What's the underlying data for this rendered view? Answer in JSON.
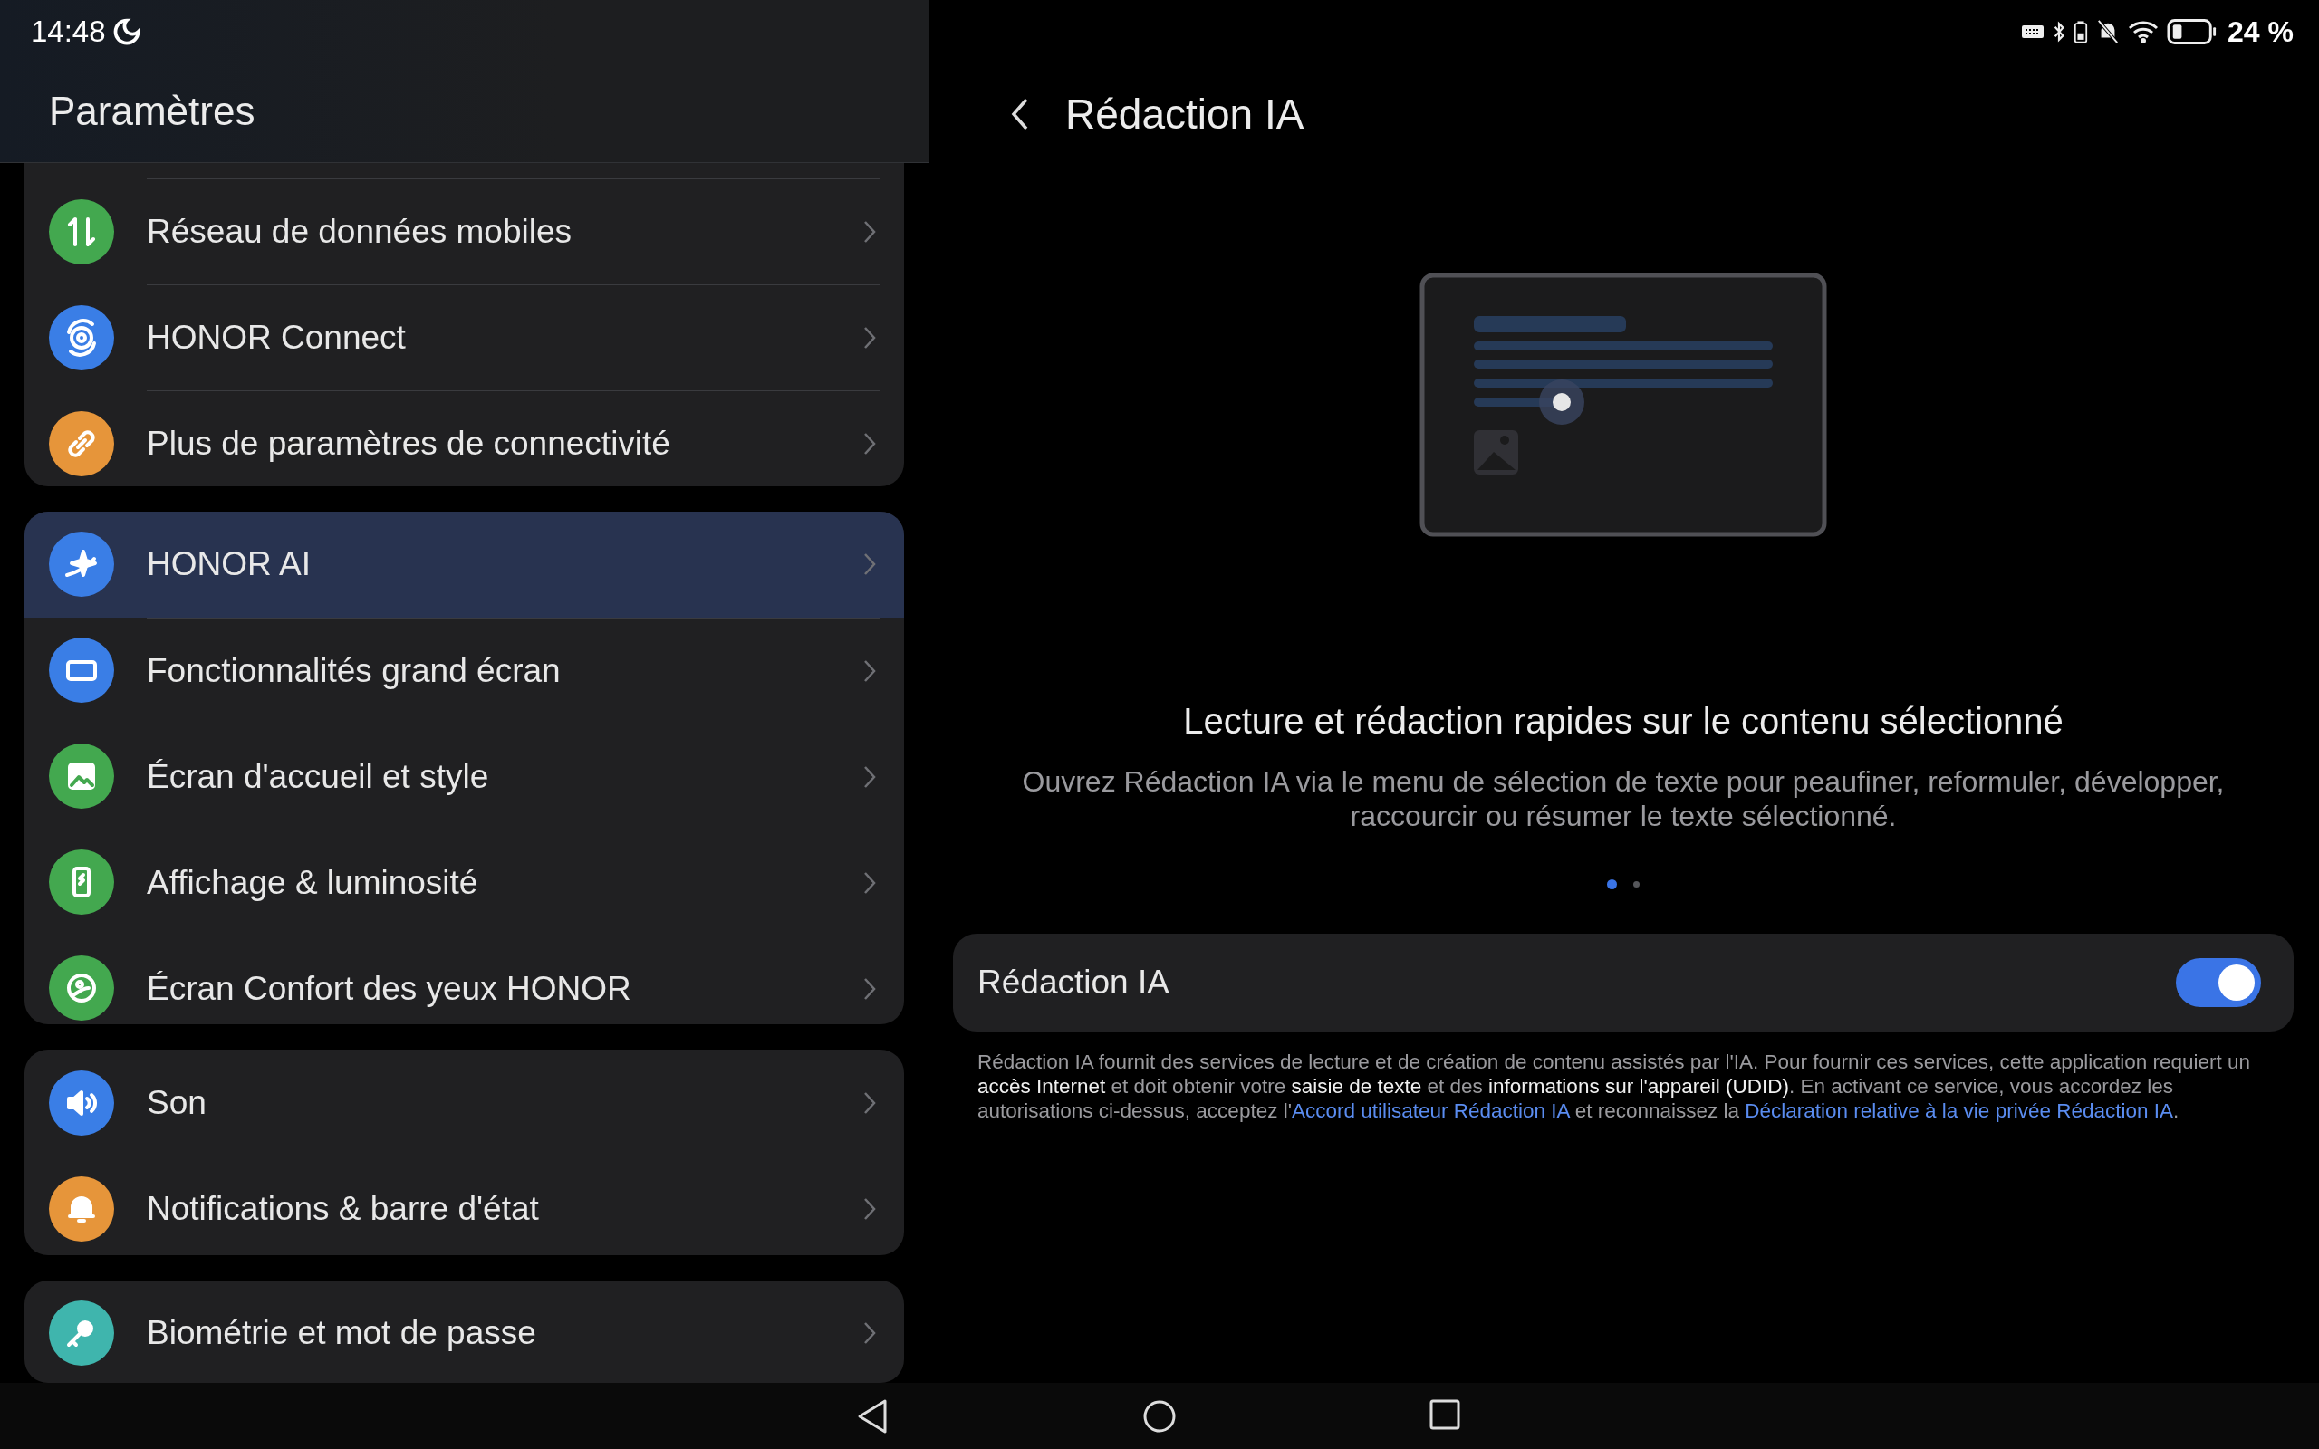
{
  "status_bar": {
    "time": "14:48",
    "battery": "24 %"
  },
  "settings": {
    "title": "Paramètres",
    "groups": [
      {
        "items": [
          {
            "label": "Réseau de données mobiles",
            "kind": "data",
            "color": "#43a84f",
            "selected": false
          },
          {
            "label": "HONOR Connect",
            "kind": "connect",
            "color": "#3a7ee6",
            "selected": false
          },
          {
            "label": "Plus de paramètres de connectivité",
            "kind": "link",
            "color": "#e6953a",
            "selected": false
          }
        ]
      },
      {
        "items": [
          {
            "label": "HONOR AI",
            "kind": "ai",
            "color": "#3a7ee6",
            "selected": true
          },
          {
            "label": "Fonctionnalités grand écran",
            "kind": "screen",
            "color": "#3a7ee6",
            "selected": false
          },
          {
            "label": "Écran d'accueil et style",
            "kind": "image",
            "color": "#43a84f",
            "selected": false
          },
          {
            "label": "Affichage & luminosité",
            "kind": "display",
            "color": "#43a84f",
            "selected": false
          },
          {
            "label": "Écran Confort des yeux HONOR",
            "kind": "eye",
            "color": "#43a84f",
            "selected": false
          }
        ]
      },
      {
        "items": [
          {
            "label": "Son",
            "kind": "sound",
            "color": "#3a7ee6",
            "selected": false
          },
          {
            "label": "Notifications & barre d'état",
            "kind": "bell",
            "color": "#e6953a",
            "selected": false
          }
        ]
      },
      {
        "items": [
          {
            "label": "Biométrie et mot de passe",
            "kind": "key",
            "color": "#3fb5ad",
            "selected": false
          }
        ]
      }
    ]
  },
  "detail": {
    "title": "Rédaction IA",
    "heading": "Lecture et rédaction rapides sur le contenu sélectionné",
    "description": "Ouvrez Rédaction IA via le menu de sélection de texte pour peaufiner, reformuler, développer, raccourcir ou résumer le texte sélectionné.",
    "pages": [
      {
        "selected": true
      },
      {
        "selected": false
      }
    ],
    "switch": {
      "label": "Rédaction IA",
      "on": true
    },
    "disclaimer": [
      {
        "kind": "text",
        "text": "Rédaction IA fournit des services de lecture et de création de contenu assistés par l'IA. Pour fournir ces services, cette application requiert un **accès Internet** et doit obtenir votre **saisie de texte** et des **informations sur l'appareil (UDID)**. En activant ce service, vous accordez les autorisations ci-dessus, acceptez l'"
      },
      {
        "kind": "link",
        "text": "Accord utilisateur Rédaction IA"
      },
      {
        "kind": "text",
        "text": " et reconnaissez la "
      },
      {
        "kind": "link",
        "text": "Déclaration relative à la vie privée Rédaction IA"
      },
      {
        "kind": "text",
        "text": "."
      }
    ]
  }
}
